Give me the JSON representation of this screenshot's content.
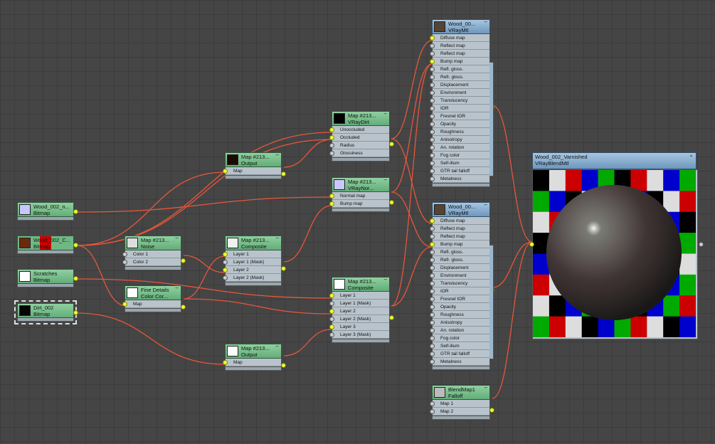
{
  "nodes": {
    "wood_n": {
      "title": "Wood_002_n...",
      "type": "Bitmap",
      "thumb": "#c8c8ff"
    },
    "wood_c": {
      "title": "Wood_002_C...",
      "type": "Bitmap",
      "thumb": "#6b2a10"
    },
    "scratches": {
      "title": "Scratches",
      "type": "Bitmap",
      "thumb": "#ffffff"
    },
    "dirt": {
      "title": "Dirt_002",
      "type": "Bitmap",
      "thumb": "#050505"
    },
    "noise": {
      "title": "Map #213...",
      "type": "Noise",
      "thumb": "#dddddd",
      "slots": [
        "Color 1",
        "Color 2"
      ]
    },
    "finedetails": {
      "title": "Fine Details",
      "type": "Color Cor...",
      "thumb": "#ffffff",
      "slots": [
        "Map"
      ]
    },
    "output1": {
      "title": "Map #213...",
      "type": "Output",
      "thumb": "#1a0a00",
      "slots": [
        "Map"
      ]
    },
    "composite1": {
      "title": "Map #213...",
      "type": "Composite",
      "thumb": "#f0f0f0",
      "slots": [
        "Layer 1",
        "Layer 1 (Mask)",
        "Layer 2",
        "Layer 2 (Mask)"
      ]
    },
    "output2": {
      "title": "Map #213...",
      "type": "Output",
      "thumb": "#ffffff",
      "slots": [
        "Map"
      ]
    },
    "vraydirt": {
      "title": "Map #213...",
      "type": "VRayDirt",
      "thumb": "#000000",
      "slots": [
        "Unoccluded",
        "Occluded",
        "Radius",
        "Glossiness"
      ]
    },
    "vraynormal": {
      "title": "Map #213...",
      "type": "VRayNor...",
      "thumb": "#c8c8ff",
      "slots": [
        "Normal map",
        "Bump map"
      ]
    },
    "composite2": {
      "title": "Map #213...",
      "type": "Composite",
      "thumb": "#ffffff",
      "slots": [
        "Layer 1",
        "Layer 1 (Mask)",
        "Layer 2",
        "Layer 2 (Mask)",
        "Layer 3",
        "Layer 3 (Mask)"
      ]
    },
    "vraymtl1": {
      "title": "Wood_00...",
      "type": "VRayMtl",
      "thumb": "#554433",
      "slots": [
        "Diffuse map",
        "Reflect map",
        "Reflect map",
        "Bump map",
        "Refl. gloss.",
        "Refr. gloss.",
        "Displacement",
        "Environment",
        "Translucency",
        "IOR",
        "Fresnel IOR",
        "Opacity",
        "Roughness",
        "Anisotropy",
        "An. rotation",
        "Fog color",
        "Self-illum",
        "GTR tail falloff",
        "Metalness"
      ]
    },
    "vraymtl2": {
      "title": "Wood_00...",
      "type": "VRayMtl",
      "thumb": "#554433",
      "slots": [
        "Diffuse map",
        "Reflect map",
        "Reflect map",
        "Bump map",
        "Refl. gloss.",
        "Refr. gloss.",
        "Displacement",
        "Environment",
        "Translucency",
        "IOR",
        "Fresnel IOR",
        "Opacity",
        "Roughness",
        "Anisotropy",
        "An. rotation",
        "Fog color",
        "Self-illum",
        "GTR tail falloff",
        "Metalness"
      ]
    },
    "falloff": {
      "title": "BlendMap1",
      "type": "Falloff",
      "thumb": "#bbbbbb",
      "slots": [
        "Map 1",
        "Map 2"
      ]
    },
    "blend": {
      "title": "Wood_002_Varnished",
      "type": "VRayBlendMtl"
    }
  },
  "colors": {
    "wire": "#e8563a",
    "socket_active": "#e8ff3a",
    "map_header": "#6fb883",
    "material_header": "#7ea5c9",
    "node_body": "#b8c3cc",
    "background": "#454545"
  },
  "preview_checker": {
    "colors": [
      "#000000",
      "#cc0000",
      "#00aa00",
      "#0000cc",
      "#dddddd"
    ],
    "rows": [
      [
        0,
        4,
        1,
        3,
        2,
        0,
        1,
        4,
        3,
        2
      ],
      [
        2,
        3,
        0,
        4,
        1,
        2,
        3,
        0,
        4,
        1
      ],
      [
        4,
        1,
        2,
        3,
        0,
        4,
        1,
        2,
        3,
        0
      ],
      [
        0,
        3,
        4,
        1,
        2,
        0,
        3,
        4,
        1,
        2
      ],
      [
        3,
        2,
        1,
        0,
        4,
        3,
        2,
        1,
        0,
        4
      ],
      [
        1,
        4,
        0,
        3,
        2,
        1,
        4,
        0,
        3,
        2
      ],
      [
        4,
        0,
        3,
        2,
        1,
        4,
        0,
        3,
        2,
        1
      ],
      [
        2,
        1,
        4,
        0,
        3,
        2,
        1,
        4,
        0,
        3
      ]
    ]
  },
  "icons": {
    "node_menu": "minimize-icon",
    "blend_menu": "chevron-down-icon"
  }
}
